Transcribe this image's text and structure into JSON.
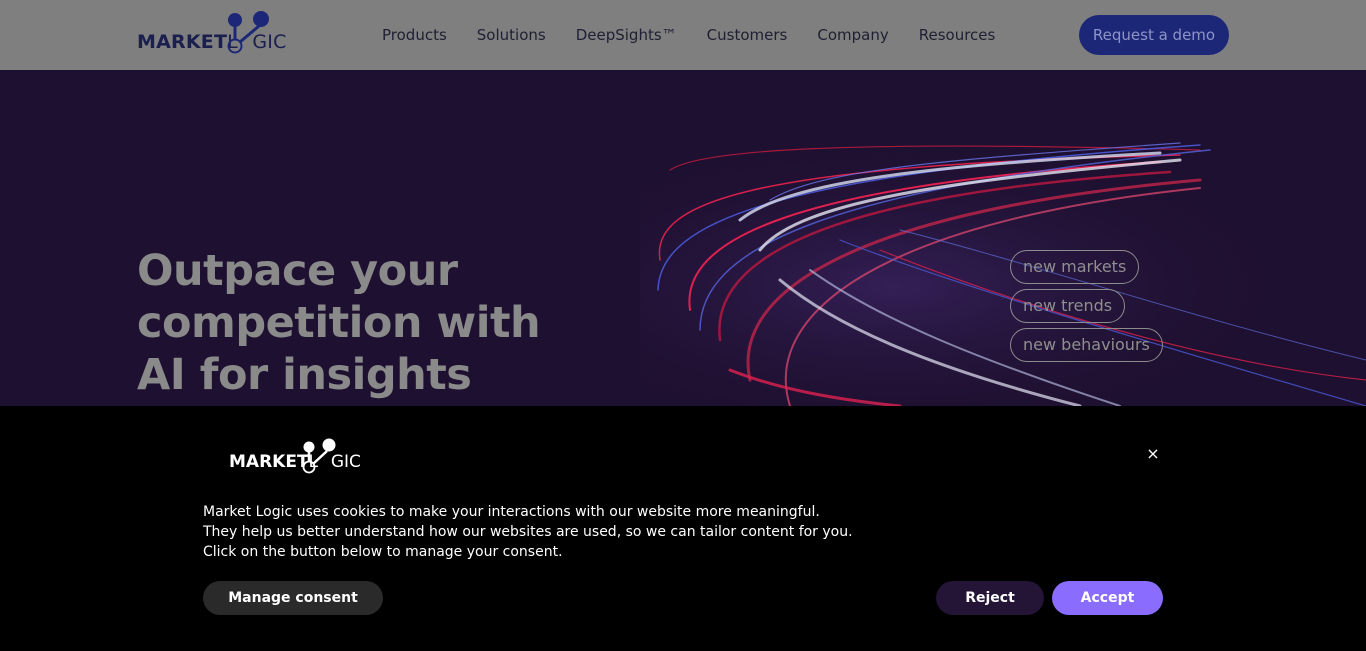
{
  "header": {
    "logo": {
      "bold": "MARKET",
      "light": "GIC",
      "o_letter": "O",
      "l_letter": "L"
    },
    "nav": [
      "Products",
      "Solutions",
      "DeepSights™",
      "Customers",
      "Company",
      "Resources"
    ],
    "cta_label": "Request a demo"
  },
  "hero": {
    "title_lines": [
      "Outpace your",
      "competition with",
      "AI for insights"
    ],
    "tags": [
      "new markets",
      "new trends",
      "new behaviours"
    ]
  },
  "cookie": {
    "close_symbol": "×",
    "lines": [
      "Market Logic uses cookies to make your interactions with our website more meaningful.",
      "They help us better understand how our websites are used, so we can tailor content for you.",
      "Click on the button below to manage your consent."
    ],
    "manage_label": "Manage consent",
    "reject_label": "Reject",
    "accept_label": "Accept"
  },
  "colors": {
    "header_bg": "#7f7f7f",
    "hero_bg": "#1e1030",
    "brand_navy": "#1c2877",
    "accent_purple": "#8a6cff",
    "streak_red": "#d8204a",
    "streak_blue": "#4a5ad8"
  },
  "icons": [
    "logo-molecule-icon",
    "close-icon"
  ]
}
